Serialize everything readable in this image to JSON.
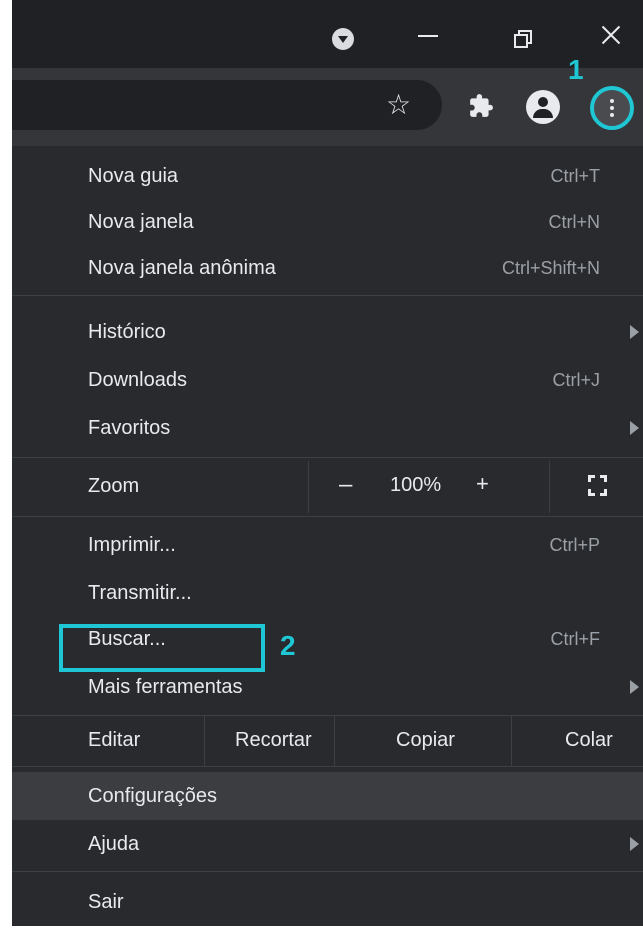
{
  "title_bar": {
    "tab_search_icon": "tab-search-icon",
    "controls": [
      "minimize-icon",
      "restore-icon",
      "close-icon"
    ]
  },
  "toolbar": {
    "icons": [
      "star-icon",
      "extensions-puzzle-icon",
      "profile-icon",
      "menu-kebab-icon"
    ],
    "star_glyph": "☆"
  },
  "annotations": {
    "step1": "1",
    "step2": "2",
    "color": "#1fc7d4"
  },
  "menu": {
    "group1": [
      {
        "label": "Nova guia",
        "shortcut": "Ctrl+T"
      },
      {
        "label": "Nova janela",
        "shortcut": "Ctrl+N"
      },
      {
        "label": "Nova janela anônima",
        "shortcut": "Ctrl+Shift+N"
      }
    ],
    "group2": [
      {
        "label": "Histórico",
        "submenu": true
      },
      {
        "label": "Downloads",
        "shortcut": "Ctrl+J"
      },
      {
        "label": "Favoritos",
        "submenu": true
      }
    ],
    "zoom": {
      "label": "Zoom",
      "minus": "–",
      "value": "100%",
      "plus": "+"
    },
    "group3": [
      {
        "label": "Imprimir...",
        "shortcut": "Ctrl+P"
      },
      {
        "label": "Transmitir..."
      },
      {
        "label": "Buscar...",
        "shortcut": "Ctrl+F"
      },
      {
        "label": "Mais ferramentas",
        "submenu": true
      }
    ],
    "edit": {
      "label": "Editar",
      "cut": "Recortar",
      "copy": "Copiar",
      "paste": "Colar"
    },
    "group4": [
      {
        "label": "Configurações"
      },
      {
        "label": "Ajuda",
        "submenu": true
      }
    ],
    "group5": [
      {
        "label": "Sair"
      }
    ]
  },
  "colors": {
    "background": "#202124",
    "toolbar": "#35363a",
    "menu": "#292a2d",
    "text": "#e8eaed",
    "shortcut_text": "#9aa0a6",
    "accent": "#1fc7d4"
  }
}
